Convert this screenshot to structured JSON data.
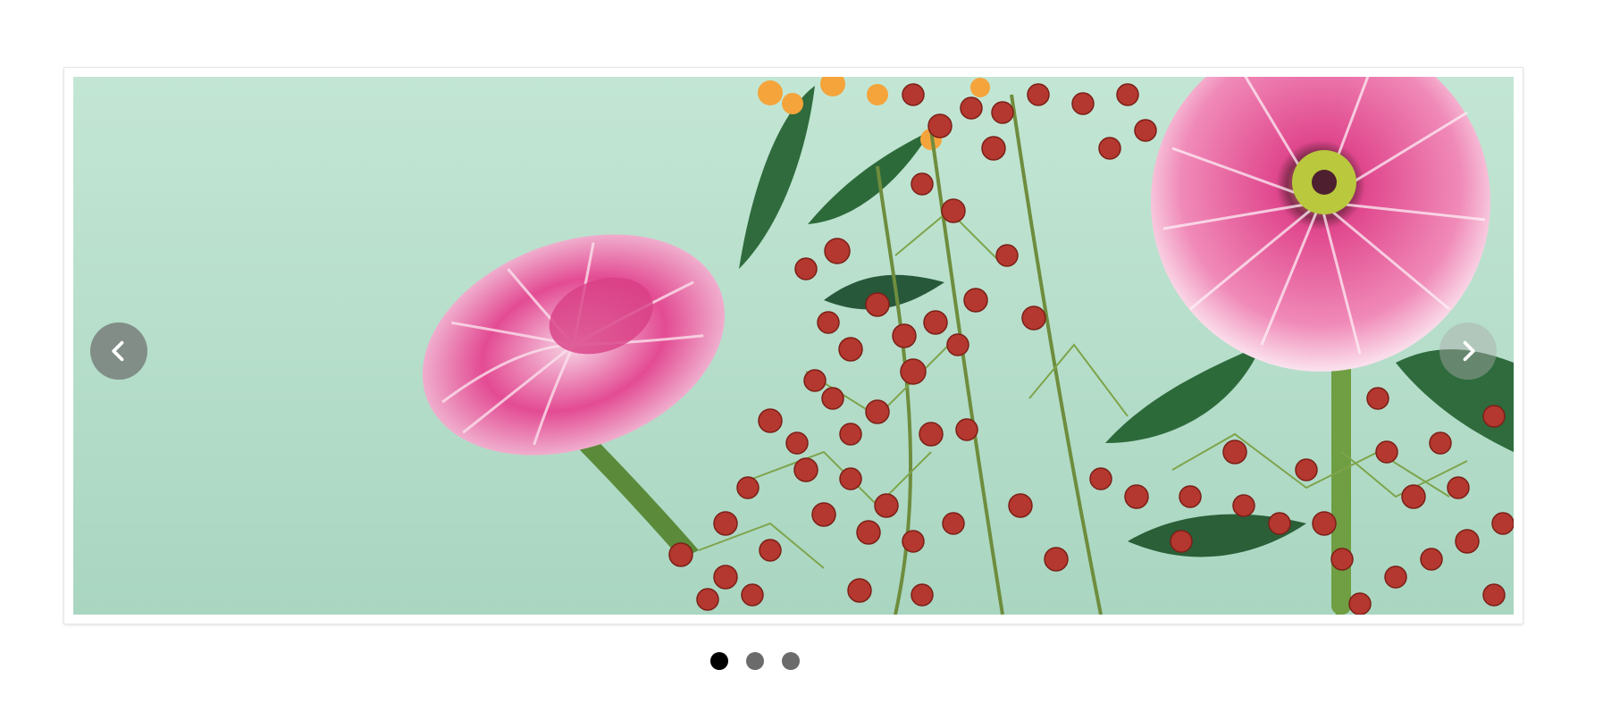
{
  "carousel": {
    "slide_count": 3,
    "active_index": 0,
    "prev_icon": "chevron-left-icon",
    "next_icon": "chevron-right-icon",
    "colors": {
      "backdrop": "#b7dfcb",
      "arrow_bg": "#6e6e6e",
      "dot_active": "#000000",
      "dot_inactive": "#6b6b6b"
    }
  }
}
